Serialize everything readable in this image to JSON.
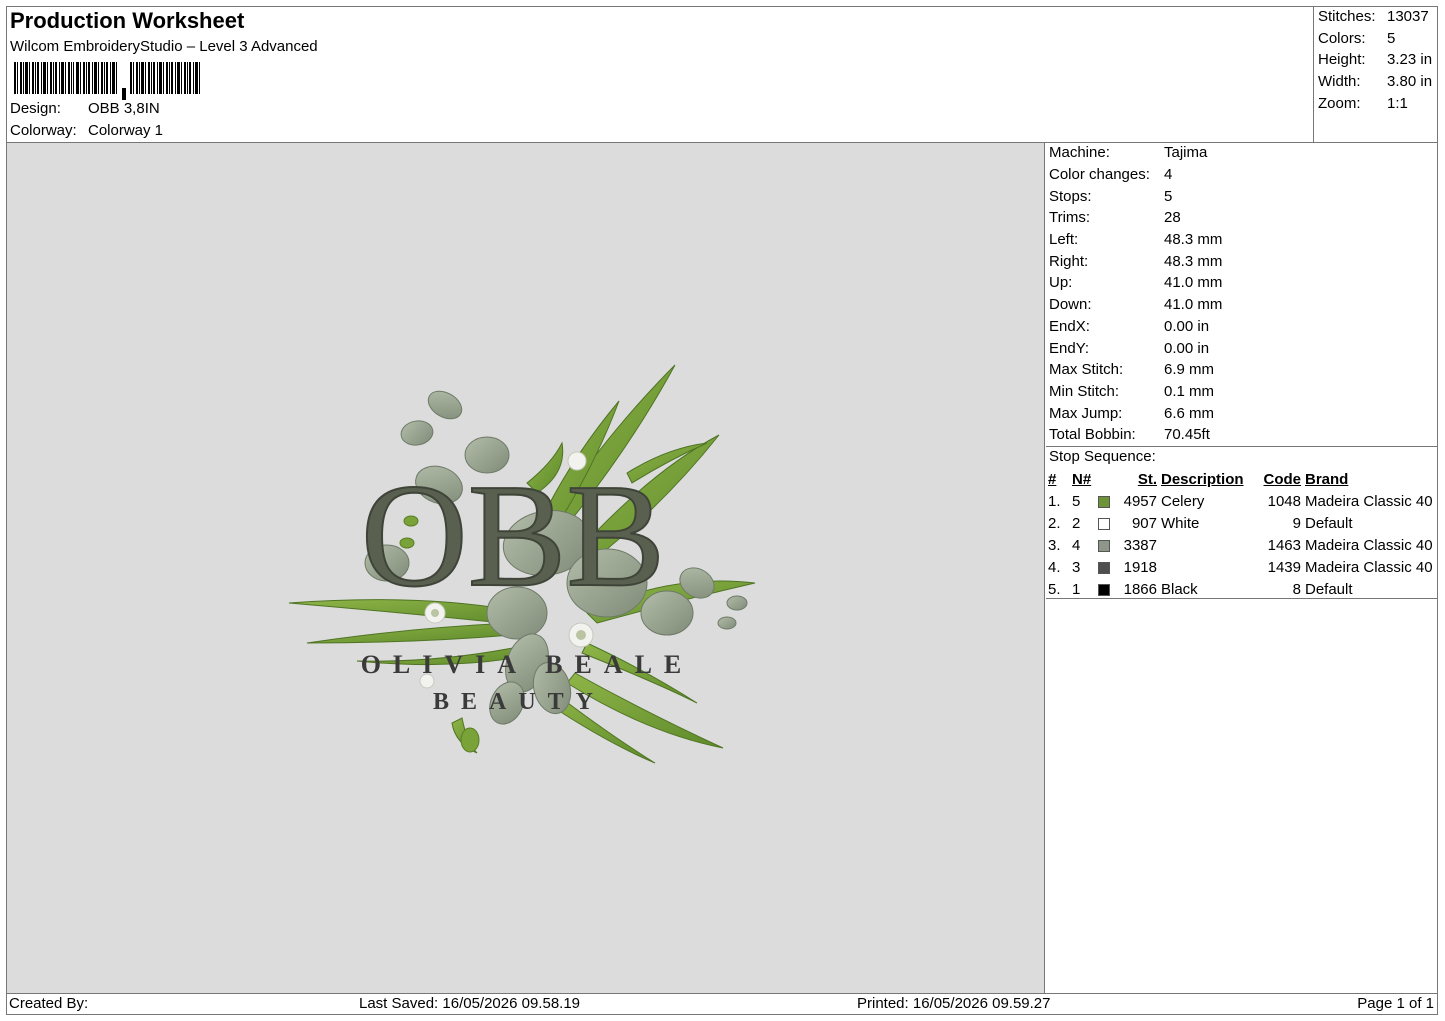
{
  "header": {
    "title": "Production Worksheet",
    "software": "Wilcom EmbroideryStudio – Level 3 Advanced",
    "design_label": "Design:",
    "design_value": "OBB 3,8IN",
    "colorway_label": "Colorway:",
    "colorway_value": "Colorway 1"
  },
  "stats": {
    "stitches_label": "Stitches:",
    "stitches_value": "13037",
    "colors_label": "Colors:",
    "colors_value": "5",
    "height_label": "Height:",
    "height_value": "3.23 in",
    "width_label": "Width:",
    "width_value": "3.80 in",
    "zoom_label": "Zoom:",
    "zoom_value": "1:1"
  },
  "info": {
    "machine_label": "Machine:",
    "machine_value": "Tajima",
    "color_changes_label": "Color changes:",
    "color_changes_value": "4",
    "stops_label": "Stops:",
    "stops_value": "5",
    "trims_label": "Trims:",
    "trims_value": "28",
    "left_label": "Left:",
    "left_value": "48.3 mm",
    "right_label": "Right:",
    "right_value": "48.3 mm",
    "up_label": "Up:",
    "up_value": "41.0 mm",
    "down_label": "Down:",
    "down_value": "41.0 mm",
    "endx_label": "EndX:",
    "endx_value": "0.00 in",
    "endy_label": "EndY:",
    "endy_value": "0.00 in",
    "max_stitch_label": "Max Stitch:",
    "max_stitch_value": "6.9 mm",
    "min_stitch_label": "Min Stitch:",
    "min_stitch_value": "0.1 mm",
    "max_jump_label": "Max Jump:",
    "max_jump_value": "6.6 mm",
    "total_bobbin_label": "Total Bobbin:",
    "total_bobbin_value": "70.45ft"
  },
  "stop_sequence": {
    "label": "Stop Sequence:",
    "headers": {
      "num": "#",
      "n": "N#",
      "st": "St.",
      "description": "Description",
      "code": "Code",
      "brand": "Brand"
    },
    "rows": [
      {
        "num": "1.",
        "n": "5",
        "color": "#6f9339",
        "st": "4957",
        "description": "Celery",
        "code": "1048",
        "brand": "Madeira Classic 40"
      },
      {
        "num": "2.",
        "n": "2",
        "color": "#ffffff",
        "st": "907",
        "description": "White",
        "code": "9",
        "brand": "Default"
      },
      {
        "num": "3.",
        "n": "4",
        "color": "#8e958a",
        "st": "3387",
        "description": "",
        "code": "1463",
        "brand": "Madeira Classic 40"
      },
      {
        "num": "4.",
        "n": "3",
        "color": "#4d4f4c",
        "st": "1918",
        "description": "",
        "code": "1439",
        "brand": "Madeira Classic 40"
      },
      {
        "num": "5.",
        "n": "1",
        "color": "#000000",
        "st": "1866",
        "description": "Black",
        "code": "8",
        "brand": "Default"
      }
    ]
  },
  "design_preview": {
    "monogram": "OBB",
    "line1": "OLIVIA BEALE",
    "line2": "BEAUTY",
    "background": "#dcdcdc"
  },
  "footer": {
    "created_by": "Created By:",
    "last_saved": "Last Saved: 16/05/2026 09.58.19",
    "printed": "Printed: 16/05/2026 09.59.27",
    "page": "Page 1 of 1"
  }
}
